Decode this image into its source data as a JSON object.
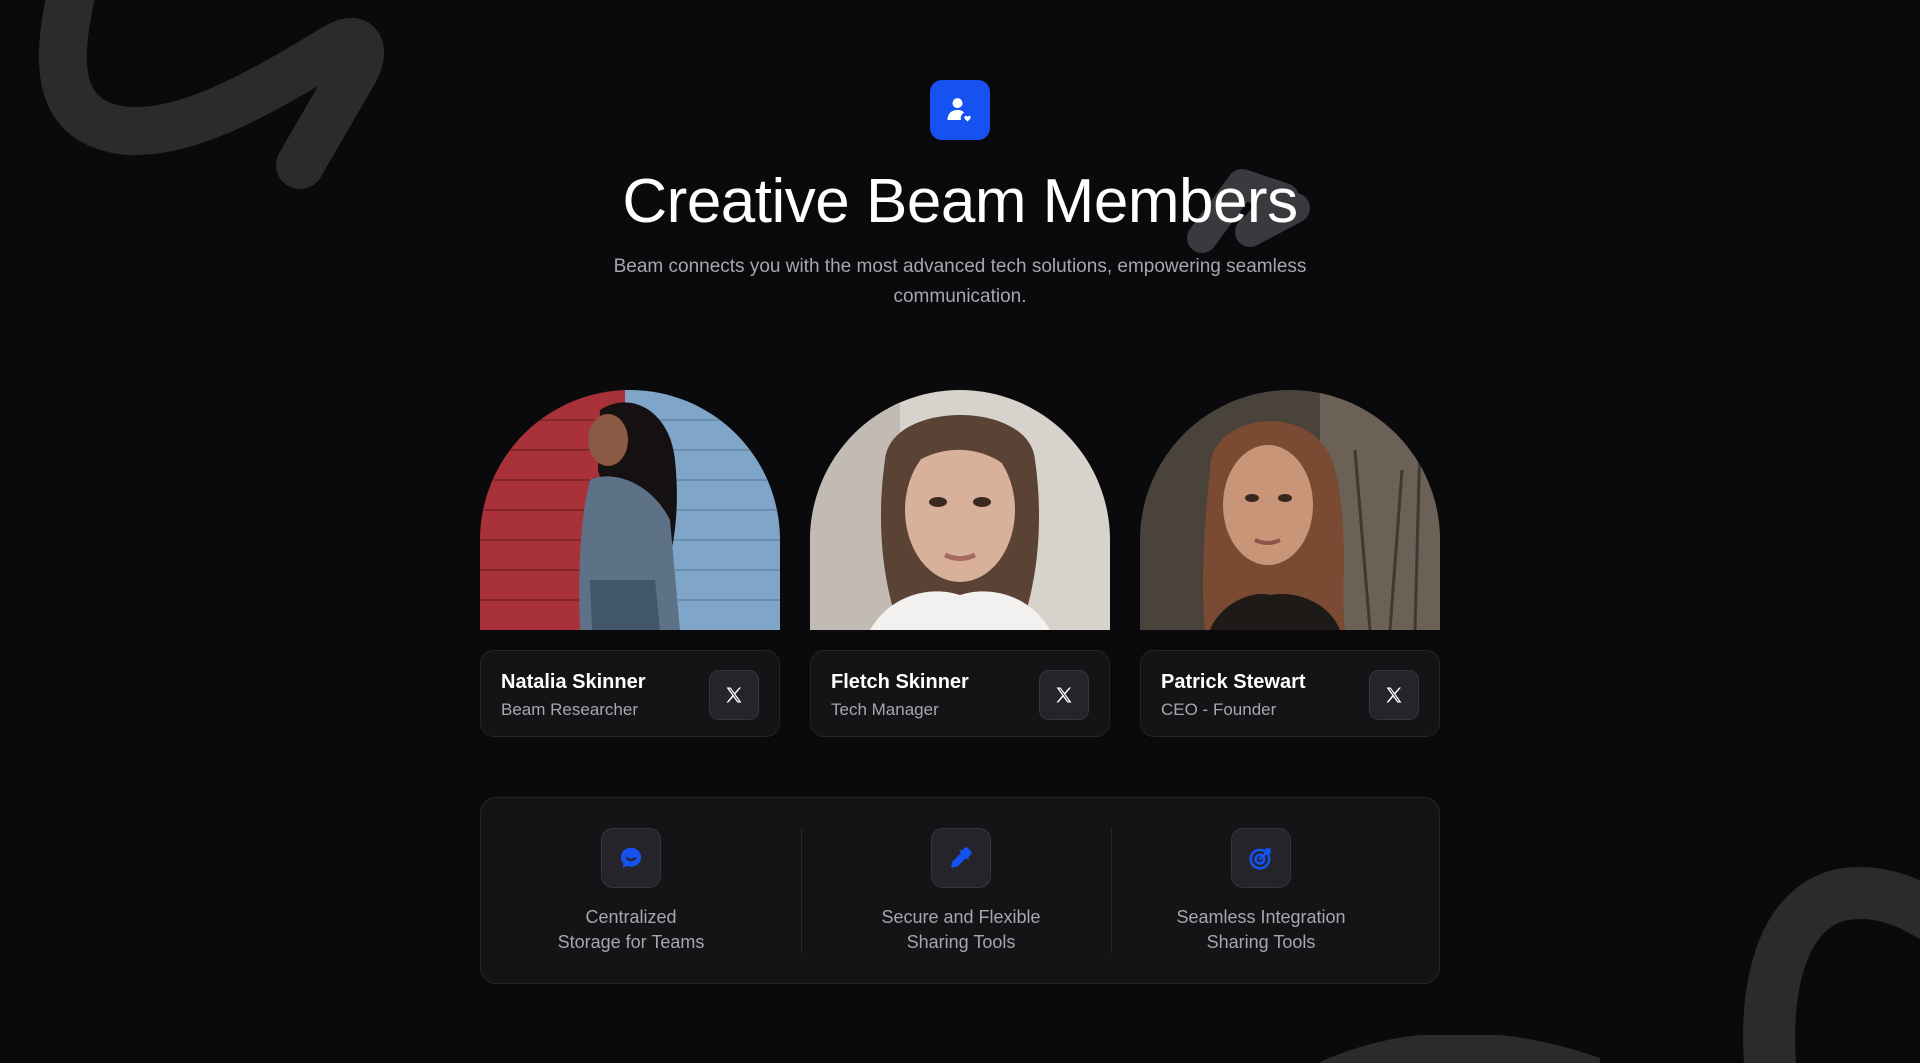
{
  "header": {
    "icon": "user-heart-icon",
    "title": "Creative Beam Members",
    "subtitle": "Beam connects you with the most advanced tech solutions, empowering seamless communication."
  },
  "members": [
    {
      "name": "Natalia Skinner",
      "role": "Beam Researcher",
      "social_icon": "x-logo-icon"
    },
    {
      "name": "Fletch Skinner",
      "role": "Tech Manager",
      "social_icon": "x-logo-icon"
    },
    {
      "name": "Patrick Stewart",
      "role": "CEO - Founder",
      "social_icon": "x-logo-icon"
    }
  ],
  "features": [
    {
      "icon": "chat-bubble-icon",
      "line1": "Centralized",
      "line2": "Storage for Teams"
    },
    {
      "icon": "eyedropper-icon",
      "line1": "Secure and Flexible",
      "line2": "Sharing Tools"
    },
    {
      "icon": "target-icon",
      "line1": "Seamless Integration",
      "line2": "Sharing Tools"
    }
  ],
  "colors": {
    "background": "#0a0a0c",
    "accent": "#1652f0",
    "card": "#141417",
    "muted_text": "#a6a6ad"
  }
}
